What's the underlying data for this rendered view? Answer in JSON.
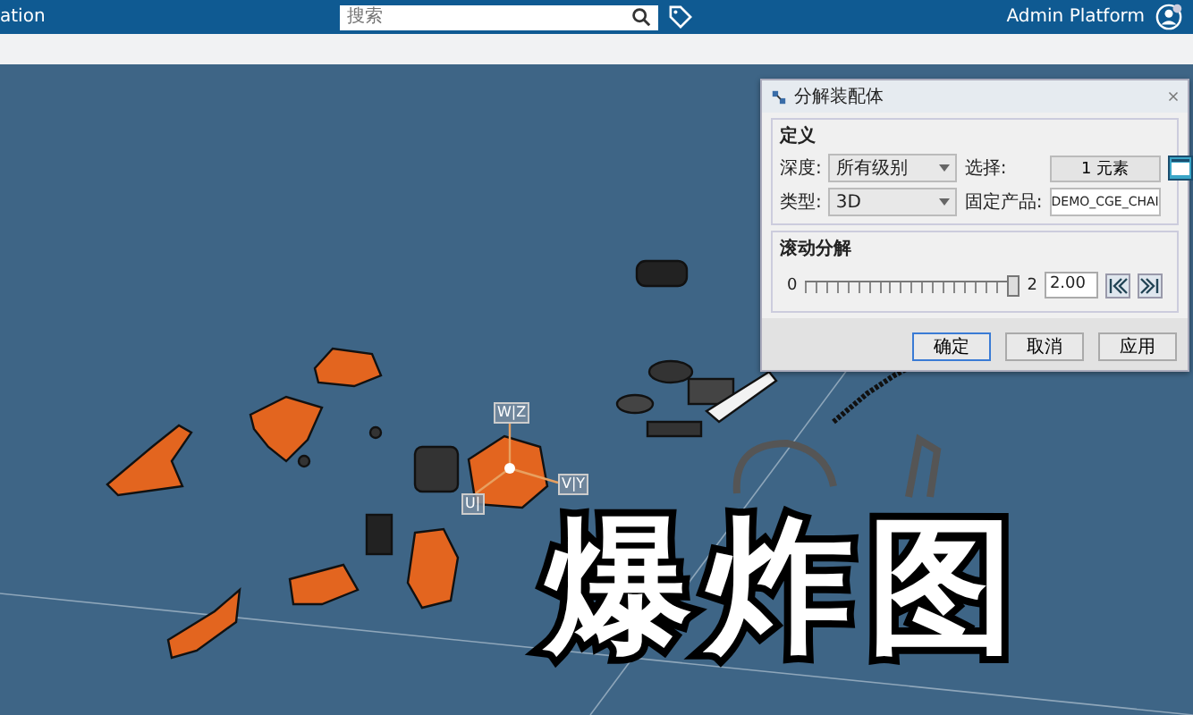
{
  "top_bar": {
    "app_title": "ation",
    "search": {
      "placeholder": "搜索"
    },
    "user": "Admin Platform"
  },
  "viewport": {
    "compass_labels": [
      "W|Z",
      "V|Y",
      "U|"
    ],
    "caption": "爆炸图"
  },
  "dialog": {
    "title": "分解装配体",
    "definition": {
      "heading": "定义",
      "fields": [
        {
          "label": "深度:",
          "value": "所有级别",
          "kind": "dropdown"
        },
        {
          "label": "选择:",
          "value": "1 元素",
          "kind": "button"
        },
        {
          "label": "类型:",
          "value": "3D",
          "kind": "dropdown"
        },
        {
          "label": "固定产品:",
          "value": "DEMO_CGE_CHAI",
          "kind": "text"
        }
      ]
    },
    "scroll": {
      "heading": "滚动分解",
      "min": "0",
      "max": "2",
      "level": 1,
      "value": "2.00"
    },
    "buttons": [
      "确定",
      "取消",
      "应用"
    ]
  }
}
